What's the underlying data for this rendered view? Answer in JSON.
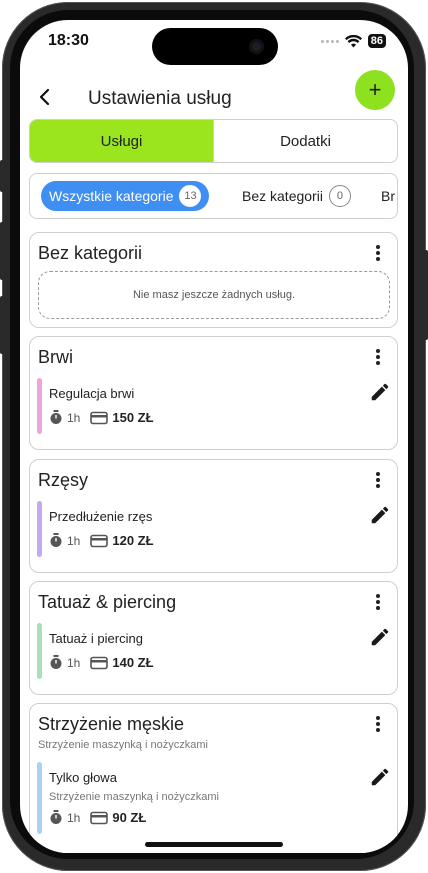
{
  "status": {
    "time": "18:30",
    "battery": "86"
  },
  "header": {
    "title": "Ustawienia usług",
    "back_icon": "chevron-left-icon",
    "add_icon": "plus-icon",
    "add_label": "+",
    "accent": "#8de11e"
  },
  "tabs": [
    {
      "label": "Usługi",
      "active": true
    },
    {
      "label": "Dodatki",
      "active": false
    }
  ],
  "filters": [
    {
      "label": "Wszystkie kategorie",
      "count": "13",
      "active": true
    },
    {
      "label": "Bez kategorii",
      "count": "0",
      "active": false
    },
    {
      "label": "Br",
      "count": "",
      "active": false
    }
  ],
  "categories": [
    {
      "title": "Bez kategorii",
      "empty_text": "Nie masz jeszcze żadnych usług."
    },
    {
      "title": "Brwi",
      "services": [
        {
          "name": "Regulacja brwi",
          "duration": "1h",
          "price": "150 ZŁ",
          "color": "#f0a5d8"
        }
      ]
    },
    {
      "title": "Rzęsy",
      "services": [
        {
          "name": "Przedłużenie rzęs",
          "duration": "1h",
          "price": "120 ZŁ",
          "color": "#c4a8f0"
        }
      ]
    },
    {
      "title": "Tatuaż & piercing",
      "services": [
        {
          "name": "Tatuaż i piercing",
          "duration": "1h",
          "price": "140 ZŁ",
          "color": "#a8e0b8"
        }
      ]
    },
    {
      "title": "Strzyżenie męskie",
      "subtitle": "Strzyżenie maszynką i nożyczkami",
      "services": [
        {
          "name": "Tylko głowa",
          "description": "Strzyżenie maszynką i nożyczkami",
          "duration": "1h",
          "price": "90 ZŁ",
          "color": "#a8d4f0"
        }
      ]
    }
  ]
}
